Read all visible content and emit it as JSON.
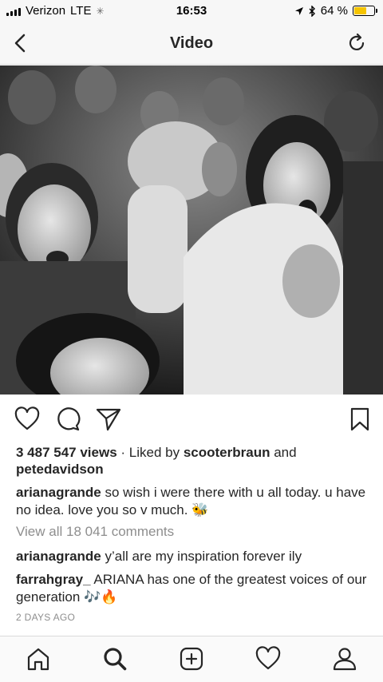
{
  "status_bar": {
    "carrier": "Verizon",
    "network": "LTE",
    "time": "16:53",
    "battery_percent": "64 %",
    "battery_level": 0.64,
    "battery_color": "#f5c400"
  },
  "nav": {
    "title": "Video",
    "back_icon": "chevron-left-icon",
    "refresh_icon": "refresh-icon"
  },
  "video": {
    "style": "grayscale concert crowd"
  },
  "actions": {
    "icons": [
      "heart-icon",
      "comment-icon",
      "share-icon",
      "bookmark-icon"
    ]
  },
  "post": {
    "views": "3 487 547 views",
    "liked_by_prefix": "· Liked by",
    "liked_user1": "scooterbraun",
    "liked_and": "and",
    "liked_user2": "petedavidson",
    "caption_user": "arianagrande",
    "caption_text": "so wish i were there with u all today. u have no idea. love you so v much. 🐝",
    "view_all_comments": "View all 18 041 comments",
    "comments": [
      {
        "user": "arianagrande",
        "text": "y’all are my inspiration forever ily"
      },
      {
        "user": "farrahgray_",
        "text": "ARIANA has one of the greatest voices of our generation 🎶🔥"
      }
    ],
    "timestamp": "2 DAYS AGO"
  },
  "tab_bar": {
    "icons": [
      "home-icon",
      "search-icon",
      "add-icon",
      "heart-icon",
      "profile-icon"
    ]
  }
}
